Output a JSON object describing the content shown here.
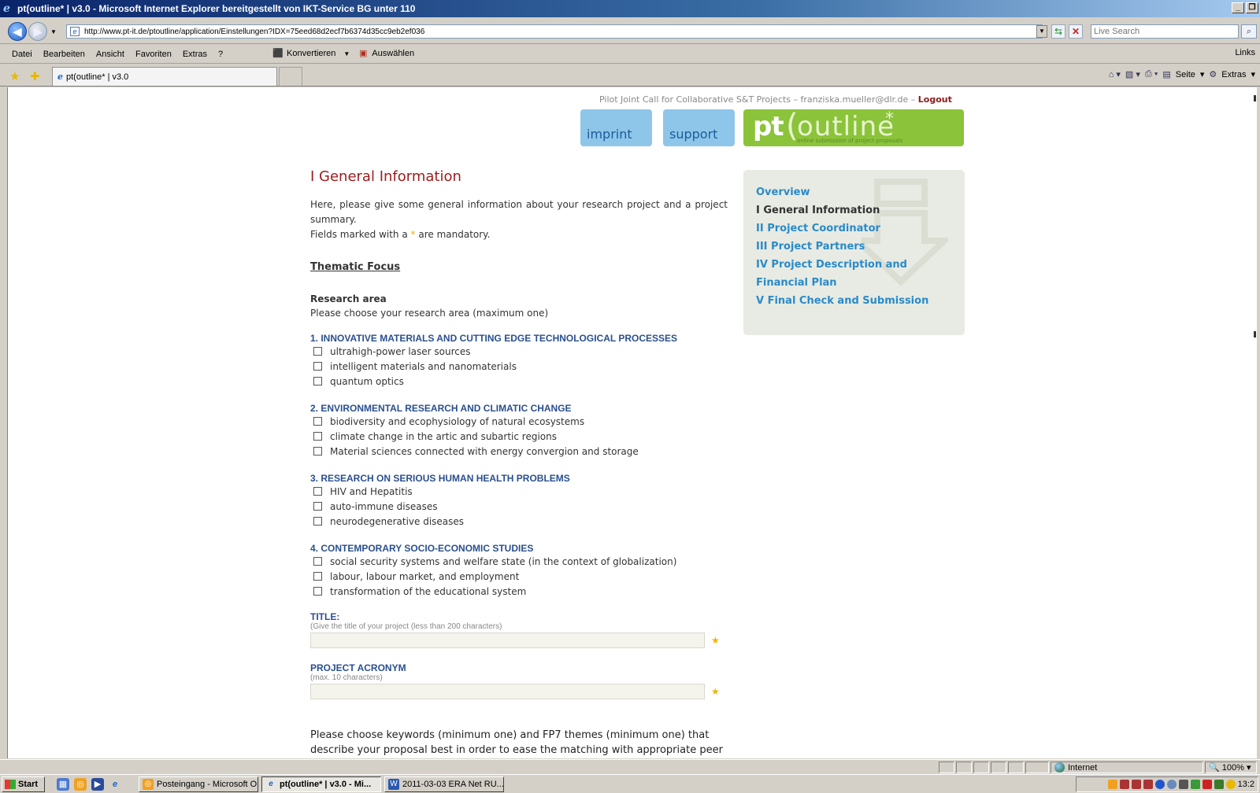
{
  "window": {
    "title": "pt(outline* | v3.0 - Microsoft Internet Explorer bereitgestellt von IKT-Service BG unter 110"
  },
  "address": {
    "url": "http://www.pt-it.de/ptoutline/application/Einstellungen?IDX=75eed68d2ecf7b6374d35cc9eb2ef036",
    "search_placeholder": "Live Search"
  },
  "menu": {
    "items": [
      "Datei",
      "Bearbeiten",
      "Ansicht",
      "Favoriten",
      "Extras",
      "?"
    ],
    "konvertieren": "Konvertieren",
    "auswaehlen": "Auswählen",
    "links": "Links"
  },
  "tabs": {
    "active_label": "pt(outline* | v3.0"
  },
  "commandbar": {
    "seite": "Seite",
    "extras": "Extras"
  },
  "page": {
    "toplinks_text": "Pilot Joint Call for Collaborative S&T Projects – franziska.mueller@dlr.de – ",
    "logout": "Logout",
    "imprint": "imprint",
    "support": "support",
    "logo_pt": "pt",
    "logo_paren": "(",
    "logo_outline": "outline",
    "logo_star": "*",
    "logo_tagline": "online submission of project proposals",
    "heading": "I General Information",
    "intro": "Here, please give some general information about your research project and a project summary.",
    "mandatory_prefix": "Fields marked with a",
    "mandatory_star": "*",
    "mandatory_suffix": "are mandatory.",
    "section_title": "Thematic Focus",
    "research_area_label": "Research area",
    "research_area_hint": "Please choose your research area (maximum one)",
    "categories": [
      {
        "title": "1. INNOVATIVE MATERIALS AND CUTTING EDGE TECHNOLOGICAL PROCESSES",
        "options": [
          "ultrahigh-power laser sources",
          "intelligent materials and nanomaterials",
          "quantum optics"
        ]
      },
      {
        "title": "2. ENVIRONMENTAL RESEARCH AND CLIMATIC CHANGE",
        "options": [
          "biodiversity and ecophysiology of natural ecosystems",
          "climate change in the artic and subartic regions",
          "Material sciences connected with energy convergion and storage"
        ]
      },
      {
        "title": "3. RESEARCH ON SERIOUS HUMAN HEALTH PROBLEMS",
        "options": [
          "HIV and Hepatitis",
          "auto-immune diseases",
          "neurodegenerative diseases"
        ]
      },
      {
        "title": "4. CONTEMPORARY SOCIO-ECONOMIC STUDIES",
        "options": [
          "social security systems and welfare state (in the context of globalization)",
          "labour, labour market, and employment",
          "transformation of the educational system"
        ]
      }
    ],
    "title_field": {
      "label": "TITLE:",
      "hint": "(Give the title of your project (less than 200 characters)",
      "value": ""
    },
    "acronym_field": {
      "label": "PROJECT ACRONYM",
      "hint": "(max. 10 characters)",
      "value": ""
    },
    "keywords_text": "Please choose keywords (minimum one) and FP7 themes (minimum one) that describe your proposal best in order to ease the matching with appropriate peer reviewers"
  },
  "sidebar": {
    "items": [
      {
        "label": "Overview",
        "current": false
      },
      {
        "label": "I General Information",
        "current": true
      },
      {
        "label": "II Project Coordinator",
        "current": false
      },
      {
        "label": "III Project Partners",
        "current": false
      },
      {
        "label": "IV Project Description and Financial Plan",
        "current": false
      },
      {
        "label": "V Final Check and Submission",
        "current": false
      }
    ]
  },
  "statusbar": {
    "zone": "Internet",
    "zoom": "100%"
  },
  "taskbar": {
    "start": "Start",
    "buttons": [
      {
        "label": "Posteingang - Microsoft O..."
      },
      {
        "label": "pt(outline* | v3.0 - Mi..."
      },
      {
        "label": "2011-03-03 ERA Net RU..."
      }
    ],
    "clock": "13:2"
  },
  "colors": {
    "heading": "#9c1c1c",
    "category": "#2a4f8e",
    "sidebar_link": "#2a8ac8",
    "logo_green": "#8bc33a",
    "header_button": "#8ec6ea",
    "mandatory_star": "#f0b400"
  }
}
